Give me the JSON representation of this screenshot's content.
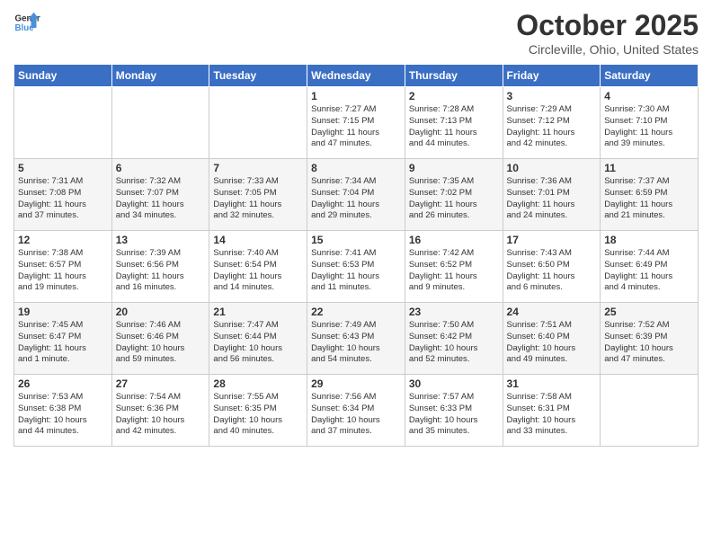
{
  "logo": {
    "line1": "General",
    "line2": "Blue"
  },
  "title": "October 2025",
  "location": "Circleville, Ohio, United States",
  "days_of_week": [
    "Sunday",
    "Monday",
    "Tuesday",
    "Wednesday",
    "Thursday",
    "Friday",
    "Saturday"
  ],
  "weeks": [
    [
      {
        "day": "",
        "info": ""
      },
      {
        "day": "",
        "info": ""
      },
      {
        "day": "",
        "info": ""
      },
      {
        "day": "1",
        "info": "Sunrise: 7:27 AM\nSunset: 7:15 PM\nDaylight: 11 hours\nand 47 minutes."
      },
      {
        "day": "2",
        "info": "Sunrise: 7:28 AM\nSunset: 7:13 PM\nDaylight: 11 hours\nand 44 minutes."
      },
      {
        "day": "3",
        "info": "Sunrise: 7:29 AM\nSunset: 7:12 PM\nDaylight: 11 hours\nand 42 minutes."
      },
      {
        "day": "4",
        "info": "Sunrise: 7:30 AM\nSunset: 7:10 PM\nDaylight: 11 hours\nand 39 minutes."
      }
    ],
    [
      {
        "day": "5",
        "info": "Sunrise: 7:31 AM\nSunset: 7:08 PM\nDaylight: 11 hours\nand 37 minutes."
      },
      {
        "day": "6",
        "info": "Sunrise: 7:32 AM\nSunset: 7:07 PM\nDaylight: 11 hours\nand 34 minutes."
      },
      {
        "day": "7",
        "info": "Sunrise: 7:33 AM\nSunset: 7:05 PM\nDaylight: 11 hours\nand 32 minutes."
      },
      {
        "day": "8",
        "info": "Sunrise: 7:34 AM\nSunset: 7:04 PM\nDaylight: 11 hours\nand 29 minutes."
      },
      {
        "day": "9",
        "info": "Sunrise: 7:35 AM\nSunset: 7:02 PM\nDaylight: 11 hours\nand 26 minutes."
      },
      {
        "day": "10",
        "info": "Sunrise: 7:36 AM\nSunset: 7:01 PM\nDaylight: 11 hours\nand 24 minutes."
      },
      {
        "day": "11",
        "info": "Sunrise: 7:37 AM\nSunset: 6:59 PM\nDaylight: 11 hours\nand 21 minutes."
      }
    ],
    [
      {
        "day": "12",
        "info": "Sunrise: 7:38 AM\nSunset: 6:57 PM\nDaylight: 11 hours\nand 19 minutes."
      },
      {
        "day": "13",
        "info": "Sunrise: 7:39 AM\nSunset: 6:56 PM\nDaylight: 11 hours\nand 16 minutes."
      },
      {
        "day": "14",
        "info": "Sunrise: 7:40 AM\nSunset: 6:54 PM\nDaylight: 11 hours\nand 14 minutes."
      },
      {
        "day": "15",
        "info": "Sunrise: 7:41 AM\nSunset: 6:53 PM\nDaylight: 11 hours\nand 11 minutes."
      },
      {
        "day": "16",
        "info": "Sunrise: 7:42 AM\nSunset: 6:52 PM\nDaylight: 11 hours\nand 9 minutes."
      },
      {
        "day": "17",
        "info": "Sunrise: 7:43 AM\nSunset: 6:50 PM\nDaylight: 11 hours\nand 6 minutes."
      },
      {
        "day": "18",
        "info": "Sunrise: 7:44 AM\nSunset: 6:49 PM\nDaylight: 11 hours\nand 4 minutes."
      }
    ],
    [
      {
        "day": "19",
        "info": "Sunrise: 7:45 AM\nSunset: 6:47 PM\nDaylight: 11 hours\nand 1 minute."
      },
      {
        "day": "20",
        "info": "Sunrise: 7:46 AM\nSunset: 6:46 PM\nDaylight: 10 hours\nand 59 minutes."
      },
      {
        "day": "21",
        "info": "Sunrise: 7:47 AM\nSunset: 6:44 PM\nDaylight: 10 hours\nand 56 minutes."
      },
      {
        "day": "22",
        "info": "Sunrise: 7:49 AM\nSunset: 6:43 PM\nDaylight: 10 hours\nand 54 minutes."
      },
      {
        "day": "23",
        "info": "Sunrise: 7:50 AM\nSunset: 6:42 PM\nDaylight: 10 hours\nand 52 minutes."
      },
      {
        "day": "24",
        "info": "Sunrise: 7:51 AM\nSunset: 6:40 PM\nDaylight: 10 hours\nand 49 minutes."
      },
      {
        "day": "25",
        "info": "Sunrise: 7:52 AM\nSunset: 6:39 PM\nDaylight: 10 hours\nand 47 minutes."
      }
    ],
    [
      {
        "day": "26",
        "info": "Sunrise: 7:53 AM\nSunset: 6:38 PM\nDaylight: 10 hours\nand 44 minutes."
      },
      {
        "day": "27",
        "info": "Sunrise: 7:54 AM\nSunset: 6:36 PM\nDaylight: 10 hours\nand 42 minutes."
      },
      {
        "day": "28",
        "info": "Sunrise: 7:55 AM\nSunset: 6:35 PM\nDaylight: 10 hours\nand 40 minutes."
      },
      {
        "day": "29",
        "info": "Sunrise: 7:56 AM\nSunset: 6:34 PM\nDaylight: 10 hours\nand 37 minutes."
      },
      {
        "day": "30",
        "info": "Sunrise: 7:57 AM\nSunset: 6:33 PM\nDaylight: 10 hours\nand 35 minutes."
      },
      {
        "day": "31",
        "info": "Sunrise: 7:58 AM\nSunset: 6:31 PM\nDaylight: 10 hours\nand 33 minutes."
      },
      {
        "day": "",
        "info": ""
      }
    ]
  ]
}
